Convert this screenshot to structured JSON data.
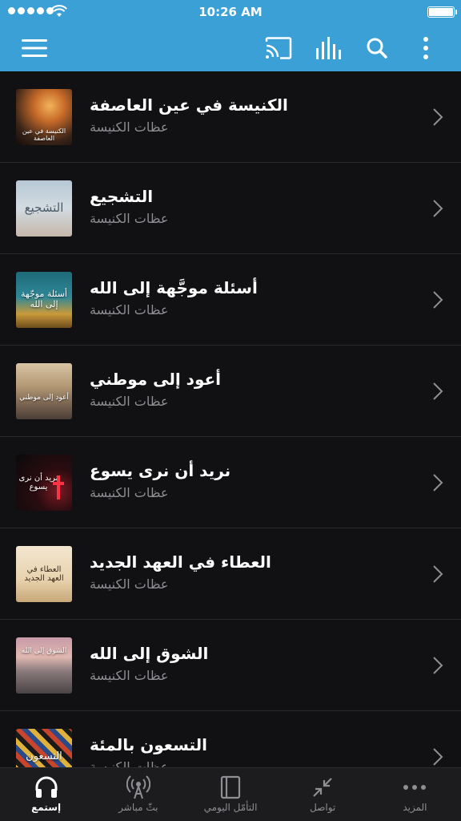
{
  "status_bar": {
    "time": "10:26 AM"
  },
  "toolbar": {
    "menu_icon": "hamburger-menu-icon",
    "cast_icon": "cast-icon",
    "audio_icon": "equalizer-icon",
    "search_icon": "search-icon",
    "more_icon": "more-vertical-icon",
    "background": "#3aa0d6"
  },
  "list": {
    "items": [
      {
        "title": "الكنيسة في عين العاصفة",
        "subtitle": "عظات الكنيسة",
        "thumb_text": "الكنيسة في عين العاصفة"
      },
      {
        "title": "التشجيع",
        "subtitle": "عظات الكنيسة",
        "thumb_text": "التشجيع"
      },
      {
        "title": "أسئلة موجَّهة إلى الله",
        "subtitle": "عظات الكنيسة",
        "thumb_text": "أسئلة موجّهة إلى الله"
      },
      {
        "title": "أعود إلى موطني",
        "subtitle": "عظات الكنيسة",
        "thumb_text": "أعود إلى موطني"
      },
      {
        "title": "نريد أن نرى يسوع",
        "subtitle": "عظات الكنيسة",
        "thumb_text": "نريد أن نرى يسوع"
      },
      {
        "title": "العطاء في العهد الجديد",
        "subtitle": "عظات الكنيسة",
        "thumb_text": "العطاء في العهد الجديد"
      },
      {
        "title": "الشوق إلى الله",
        "subtitle": "عظات الكنيسة",
        "thumb_text": "الشوق إلى الله"
      },
      {
        "title": "التسعون بالمئة",
        "subtitle": "عظات الكنيسة",
        "thumb_text": "التسعون"
      }
    ]
  },
  "tabbar": {
    "tabs": [
      {
        "label": "إستمع",
        "icon": "headphones-icon",
        "active": true
      },
      {
        "label": "بثّ مباشر",
        "icon": "broadcast-icon",
        "active": false
      },
      {
        "label": "التأمّل اليومي",
        "icon": "book-icon",
        "active": false
      },
      {
        "label": "تواصل",
        "icon": "arrows-in-icon",
        "active": false
      },
      {
        "label": "المزيد",
        "icon": "more-horizontal-icon",
        "active": false
      }
    ]
  }
}
